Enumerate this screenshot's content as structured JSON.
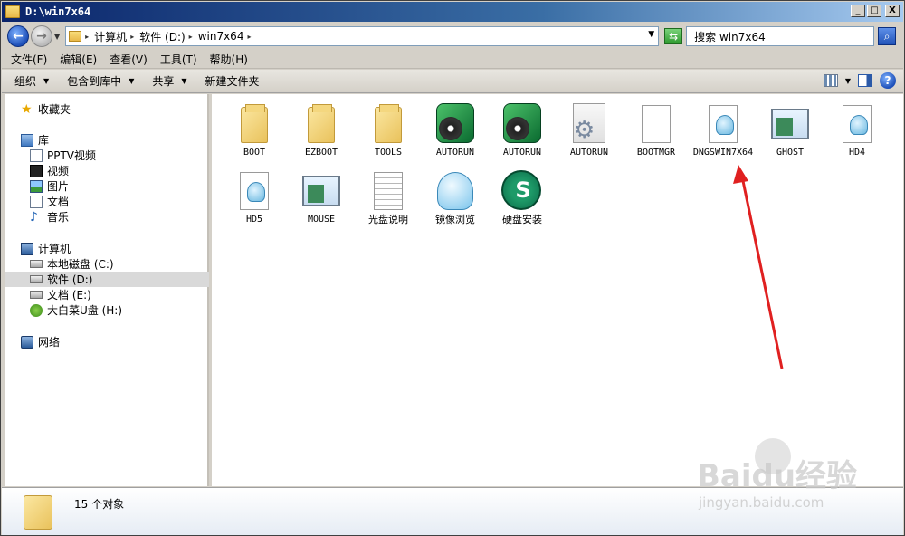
{
  "window": {
    "title": "D:\\win7x64",
    "buttons": {
      "minimize": "_",
      "maximize": "□",
      "close": "X"
    }
  },
  "address": {
    "crumbs": [
      "计算机",
      "软件 (D:)",
      "win7x64"
    ],
    "search_placeholder": "搜索 win7x64"
  },
  "menu": [
    "文件(F)",
    "编辑(E)",
    "查看(V)",
    "工具(T)",
    "帮助(H)"
  ],
  "toolbar": {
    "organize": "组织",
    "include_library": "包含到库中",
    "share": "共享",
    "new_folder": "新建文件夹"
  },
  "nav": {
    "favorites": "收藏夹",
    "libraries": "库",
    "library_items": [
      "PPTV视频",
      "视频",
      "图片",
      "文档",
      "音乐"
    ],
    "computer": "计算机",
    "drives": [
      "本地磁盘 (C:)",
      "软件 (D:)",
      "文档 (E:)",
      "大白菜U盘 (H:)"
    ],
    "network": "网络"
  },
  "files": [
    {
      "label": "BOOT",
      "icon": "folder-icon"
    },
    {
      "label": "EZBOOT",
      "icon": "folder-icon"
    },
    {
      "label": "TOOLS",
      "icon": "folder-icon"
    },
    {
      "label": "AUTORUN",
      "icon": "disc-icon"
    },
    {
      "label": "AUTORUN",
      "icon": "disc-icon"
    },
    {
      "label": "AUTORUN",
      "icon": "gear-file-icon"
    },
    {
      "label": "BOOTMGR",
      "icon": "blank-file-icon"
    },
    {
      "label": "DNGSWIN7X64",
      "icon": "ghost-file-icon"
    },
    {
      "label": "GHOST",
      "icon": "window-icon"
    },
    {
      "label": "HD4",
      "icon": "ghost-file-icon"
    },
    {
      "label": "HD5",
      "icon": "ghost-file-icon"
    },
    {
      "label": "MOUSE",
      "icon": "window-icon"
    },
    {
      "label": "光盘说明",
      "icon": "text-file-icon"
    },
    {
      "label": "镜像浏览",
      "icon": "ghost-icon"
    },
    {
      "label": "硬盘安装",
      "icon": "installer-icon"
    }
  ],
  "status": {
    "count": "15 个对象"
  },
  "watermark": {
    "logo": "Baidu经验",
    "url": "jingyan.baidu.com"
  },
  "annotation": {
    "arrow_color": "#e02020"
  }
}
